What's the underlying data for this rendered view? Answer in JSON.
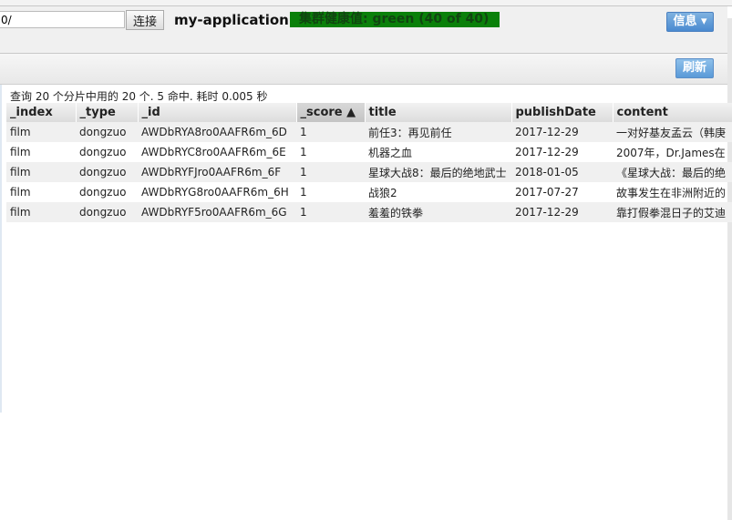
{
  "header": {
    "url_value": "0/",
    "connect_label": "连接",
    "app_name": "my-application",
    "health": "集群健康值: green (40 of 40)",
    "health_color": "#0a800a",
    "info_label": "信息 ▾"
  },
  "toolbar": {
    "refresh_label": "刷新"
  },
  "results": {
    "summary": "查询 20 个分片中用的 20 个. 5 命中. 耗时 0.005 秒",
    "columns": [
      "_index",
      "_type",
      "_id",
      "_score ▲",
      "title",
      "publishDate",
      "content"
    ],
    "rows": [
      [
        "film",
        "dongzuo",
        "AWDbRYA8ro0AAFR6m_6D",
        "1",
        "前任3：再见前任",
        "2017-12-29",
        "一对好基友孟云（韩庚"
      ],
      [
        "film",
        "dongzuo",
        "AWDbRYC8ro0AAFR6m_6E",
        "1",
        "机器之血",
        "2017-12-29",
        "2007年，Dr.James在"
      ],
      [
        "film",
        "dongzuo",
        "AWDbRYFJro0AAFR6m_6F",
        "1",
        "星球大战8：最后的绝地武士",
        "2018-01-05",
        "《星球大战：最后的绝"
      ],
      [
        "film",
        "dongzuo",
        "AWDbRYG8ro0AAFR6m_6H",
        "1",
        "战狼2",
        "2017-07-27",
        "故事发生在非洲附近的"
      ],
      [
        "film",
        "dongzuo",
        "AWDbRYF5ro0AAFR6m_6G",
        "1",
        "羞羞的铁拳",
        "2017-12-29",
        "靠打假拳混日子的艾迪"
      ]
    ]
  }
}
